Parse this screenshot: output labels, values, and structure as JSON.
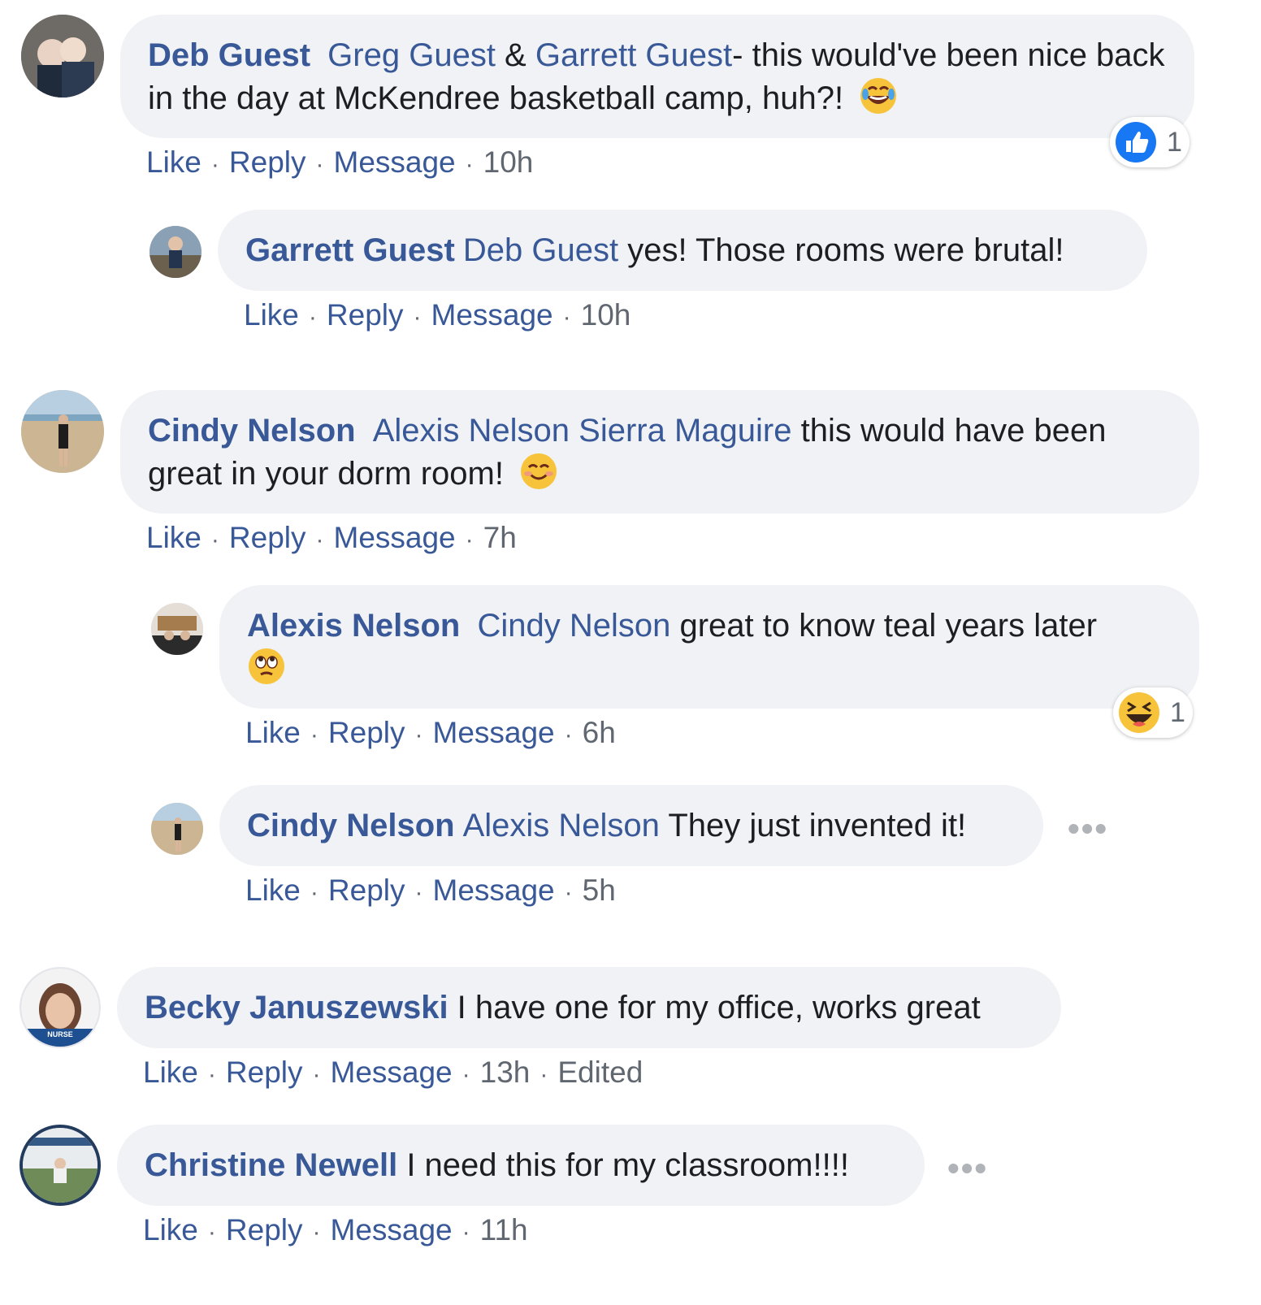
{
  "comments": [
    {
      "author": "Deb Guest",
      "tags": [
        "Greg Guest",
        " & ",
        "Garrett Guest"
      ],
      "text": "- this would've been nice back in the day at McKendree basketball camp, huh?!",
      "emoji": "laugh-tears-emoji",
      "actions": [
        "Like",
        "Reply",
        "Message"
      ],
      "time": "10h",
      "reaction": {
        "icon": "like-reaction-icon",
        "count": "1"
      }
    },
    {
      "author": "Garrett Guest",
      "tags": [
        "Deb Guest"
      ],
      "text": " yes! Those rooms were brutal!",
      "actions": [
        "Like",
        "Reply",
        "Message"
      ],
      "time": "10h"
    },
    {
      "author": "Cindy Nelson",
      "tags": [
        "Alexis Nelson",
        "Sierra Maguire"
      ],
      "text": " this would have been great in your dorm room!",
      "emoji": "smiling-blush-emoji",
      "actions": [
        "Like",
        "Reply",
        "Message"
      ],
      "time": "7h"
    },
    {
      "author": "Alexis Nelson",
      "tags": [
        "Cindy Nelson"
      ],
      "text": " great to know teal years later",
      "emoji": "eye-roll-emoji",
      "actions": [
        "Like",
        "Reply",
        "Message"
      ],
      "time": "6h",
      "reaction": {
        "icon": "haha-reaction-icon",
        "count": "1"
      }
    },
    {
      "author": "Cindy Nelson",
      "tags": [
        "Alexis Nelson"
      ],
      "text": " They just invented it!",
      "actions": [
        "Like",
        "Reply",
        "Message"
      ],
      "time": "5h"
    },
    {
      "author": "Becky Januszewski",
      "tags": [],
      "text": " I have one for my office, works great",
      "actions": [
        "Like",
        "Reply",
        "Message"
      ],
      "time": "13h",
      "edited": "Edited",
      "avatar_text": "NURSE"
    },
    {
      "author": "Christine Newell",
      "tags": [],
      "text": " I need this for my classroom!!!!",
      "actions": [
        "Like",
        "Reply",
        "Message"
      ],
      "time": "11h"
    }
  ],
  "more_options": "•••",
  "colors": {
    "link": "#385898",
    "bubble": "#f0f2f5",
    "meta": "#606770"
  }
}
